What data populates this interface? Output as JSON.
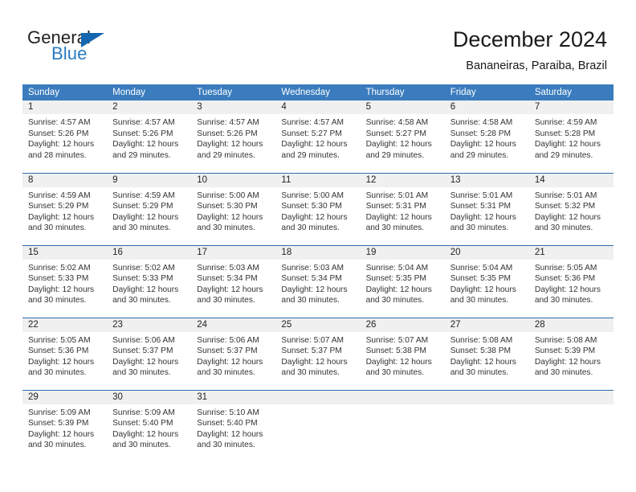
{
  "brand": {
    "word_one": "General",
    "word_two": "Blue",
    "triangle_icon": "triangle-icon",
    "accent_color": "#1667b0",
    "blue_text_color": "#2a7ac0"
  },
  "header": {
    "title": "December 2024",
    "subtitle": "Bananeiras, Paraiba, Brazil"
  },
  "theme": {
    "header_bar": "#3a7cbe",
    "row_divider": "#2f6da8",
    "daynum_band": "#f0f0f0",
    "body_text": "#333333"
  },
  "weekdays": [
    "Sunday",
    "Monday",
    "Tuesday",
    "Wednesday",
    "Thursday",
    "Friday",
    "Saturday"
  ],
  "weeks": [
    [
      {
        "day": "1",
        "sunrise": "Sunrise: 4:57 AM",
        "sunset": "Sunset: 5:26 PM",
        "daylight_line1": "Daylight: 12 hours",
        "daylight_line2": "and 28 minutes."
      },
      {
        "day": "2",
        "sunrise": "Sunrise: 4:57 AM",
        "sunset": "Sunset: 5:26 PM",
        "daylight_line1": "Daylight: 12 hours",
        "daylight_line2": "and 29 minutes."
      },
      {
        "day": "3",
        "sunrise": "Sunrise: 4:57 AM",
        "sunset": "Sunset: 5:26 PM",
        "daylight_line1": "Daylight: 12 hours",
        "daylight_line2": "and 29 minutes."
      },
      {
        "day": "4",
        "sunrise": "Sunrise: 4:57 AM",
        "sunset": "Sunset: 5:27 PM",
        "daylight_line1": "Daylight: 12 hours",
        "daylight_line2": "and 29 minutes."
      },
      {
        "day": "5",
        "sunrise": "Sunrise: 4:58 AM",
        "sunset": "Sunset: 5:27 PM",
        "daylight_line1": "Daylight: 12 hours",
        "daylight_line2": "and 29 minutes."
      },
      {
        "day": "6",
        "sunrise": "Sunrise: 4:58 AM",
        "sunset": "Sunset: 5:28 PM",
        "daylight_line1": "Daylight: 12 hours",
        "daylight_line2": "and 29 minutes."
      },
      {
        "day": "7",
        "sunrise": "Sunrise: 4:59 AM",
        "sunset": "Sunset: 5:28 PM",
        "daylight_line1": "Daylight: 12 hours",
        "daylight_line2": "and 29 minutes."
      }
    ],
    [
      {
        "day": "8",
        "sunrise": "Sunrise: 4:59 AM",
        "sunset": "Sunset: 5:29 PM",
        "daylight_line1": "Daylight: 12 hours",
        "daylight_line2": "and 30 minutes."
      },
      {
        "day": "9",
        "sunrise": "Sunrise: 4:59 AM",
        "sunset": "Sunset: 5:29 PM",
        "daylight_line1": "Daylight: 12 hours",
        "daylight_line2": "and 30 minutes."
      },
      {
        "day": "10",
        "sunrise": "Sunrise: 5:00 AM",
        "sunset": "Sunset: 5:30 PM",
        "daylight_line1": "Daylight: 12 hours",
        "daylight_line2": "and 30 minutes."
      },
      {
        "day": "11",
        "sunrise": "Sunrise: 5:00 AM",
        "sunset": "Sunset: 5:30 PM",
        "daylight_line1": "Daylight: 12 hours",
        "daylight_line2": "and 30 minutes."
      },
      {
        "day": "12",
        "sunrise": "Sunrise: 5:01 AM",
        "sunset": "Sunset: 5:31 PM",
        "daylight_line1": "Daylight: 12 hours",
        "daylight_line2": "and 30 minutes."
      },
      {
        "day": "13",
        "sunrise": "Sunrise: 5:01 AM",
        "sunset": "Sunset: 5:31 PM",
        "daylight_line1": "Daylight: 12 hours",
        "daylight_line2": "and 30 minutes."
      },
      {
        "day": "14",
        "sunrise": "Sunrise: 5:01 AM",
        "sunset": "Sunset: 5:32 PM",
        "daylight_line1": "Daylight: 12 hours",
        "daylight_line2": "and 30 minutes."
      }
    ],
    [
      {
        "day": "15",
        "sunrise": "Sunrise: 5:02 AM",
        "sunset": "Sunset: 5:33 PM",
        "daylight_line1": "Daylight: 12 hours",
        "daylight_line2": "and 30 minutes."
      },
      {
        "day": "16",
        "sunrise": "Sunrise: 5:02 AM",
        "sunset": "Sunset: 5:33 PM",
        "daylight_line1": "Daylight: 12 hours",
        "daylight_line2": "and 30 minutes."
      },
      {
        "day": "17",
        "sunrise": "Sunrise: 5:03 AM",
        "sunset": "Sunset: 5:34 PM",
        "daylight_line1": "Daylight: 12 hours",
        "daylight_line2": "and 30 minutes."
      },
      {
        "day": "18",
        "sunrise": "Sunrise: 5:03 AM",
        "sunset": "Sunset: 5:34 PM",
        "daylight_line1": "Daylight: 12 hours",
        "daylight_line2": "and 30 minutes."
      },
      {
        "day": "19",
        "sunrise": "Sunrise: 5:04 AM",
        "sunset": "Sunset: 5:35 PM",
        "daylight_line1": "Daylight: 12 hours",
        "daylight_line2": "and 30 minutes."
      },
      {
        "day": "20",
        "sunrise": "Sunrise: 5:04 AM",
        "sunset": "Sunset: 5:35 PM",
        "daylight_line1": "Daylight: 12 hours",
        "daylight_line2": "and 30 minutes."
      },
      {
        "day": "21",
        "sunrise": "Sunrise: 5:05 AM",
        "sunset": "Sunset: 5:36 PM",
        "daylight_line1": "Daylight: 12 hours",
        "daylight_line2": "and 30 minutes."
      }
    ],
    [
      {
        "day": "22",
        "sunrise": "Sunrise: 5:05 AM",
        "sunset": "Sunset: 5:36 PM",
        "daylight_line1": "Daylight: 12 hours",
        "daylight_line2": "and 30 minutes."
      },
      {
        "day": "23",
        "sunrise": "Sunrise: 5:06 AM",
        "sunset": "Sunset: 5:37 PM",
        "daylight_line1": "Daylight: 12 hours",
        "daylight_line2": "and 30 minutes."
      },
      {
        "day": "24",
        "sunrise": "Sunrise: 5:06 AM",
        "sunset": "Sunset: 5:37 PM",
        "daylight_line1": "Daylight: 12 hours",
        "daylight_line2": "and 30 minutes."
      },
      {
        "day": "25",
        "sunrise": "Sunrise: 5:07 AM",
        "sunset": "Sunset: 5:37 PM",
        "daylight_line1": "Daylight: 12 hours",
        "daylight_line2": "and 30 minutes."
      },
      {
        "day": "26",
        "sunrise": "Sunrise: 5:07 AM",
        "sunset": "Sunset: 5:38 PM",
        "daylight_line1": "Daylight: 12 hours",
        "daylight_line2": "and 30 minutes."
      },
      {
        "day": "27",
        "sunrise": "Sunrise: 5:08 AM",
        "sunset": "Sunset: 5:38 PM",
        "daylight_line1": "Daylight: 12 hours",
        "daylight_line2": "and 30 minutes."
      },
      {
        "day": "28",
        "sunrise": "Sunrise: 5:08 AM",
        "sunset": "Sunset: 5:39 PM",
        "daylight_line1": "Daylight: 12 hours",
        "daylight_line2": "and 30 minutes."
      }
    ],
    [
      {
        "day": "29",
        "sunrise": "Sunrise: 5:09 AM",
        "sunset": "Sunset: 5:39 PM",
        "daylight_line1": "Daylight: 12 hours",
        "daylight_line2": "and 30 minutes."
      },
      {
        "day": "30",
        "sunrise": "Sunrise: 5:09 AM",
        "sunset": "Sunset: 5:40 PM",
        "daylight_line1": "Daylight: 12 hours",
        "daylight_line2": "and 30 minutes."
      },
      {
        "day": "31",
        "sunrise": "Sunrise: 5:10 AM",
        "sunset": "Sunset: 5:40 PM",
        "daylight_line1": "Daylight: 12 hours",
        "daylight_line2": "and 30 minutes."
      },
      {
        "day": "",
        "sunrise": "",
        "sunset": "",
        "daylight_line1": "",
        "daylight_line2": ""
      },
      {
        "day": "",
        "sunrise": "",
        "sunset": "",
        "daylight_line1": "",
        "daylight_line2": ""
      },
      {
        "day": "",
        "sunrise": "",
        "sunset": "",
        "daylight_line1": "",
        "daylight_line2": ""
      },
      {
        "day": "",
        "sunrise": "",
        "sunset": "",
        "daylight_line1": "",
        "daylight_line2": ""
      }
    ]
  ]
}
